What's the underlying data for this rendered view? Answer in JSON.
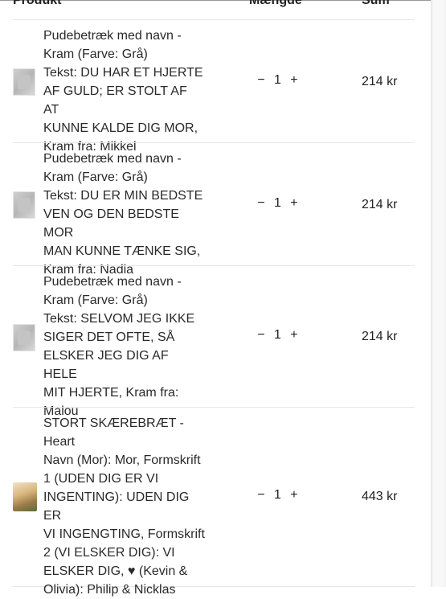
{
  "table": {
    "headers": {
      "product": "Produkt",
      "quantity": "Mængde",
      "sum": "Sum"
    },
    "rows": [
      {
        "description": "Pudebetræk med navn -\nKram (Farve: Grå)\nTekst: DU HAR ET HJERTE\nAF GULD; ER STOLT AF AT\nKUNNE KALDE DIG MOR,\nKram fra: Mikkel",
        "minus": "−",
        "qty": "1",
        "plus": "+",
        "sum": "214 kr",
        "image": "pillow-image"
      },
      {
        "description": "Pudebetræk med navn -\nKram (Farve: Grå)\nTekst: DU ER MIN BEDSTE\nVEN OG DEN BEDSTE MOR\nMAN KUNNE TÆNKE SIG,\nKram fra: Nadia",
        "minus": "−",
        "qty": "1",
        "plus": "+",
        "sum": "214 kr",
        "image": "pillow-image"
      },
      {
        "description": "Pudebetræk med navn -\nKram (Farve: Grå)\nTekst: SELVOM JEG IKKE\nSIGER DET OFTE, SÅ\nELSKER JEG DIG AF HELE\nMIT HJERTE, Kram fra:\nMalou",
        "minus": "−",
        "qty": "1",
        "plus": "+",
        "sum": "214 kr",
        "image": "pillow-image"
      },
      {
        "description": "STORT SKÆREBRÆT -\nHeart\nNavn (Mor): Mor, Formskrift\n1 (UDEN DIG ER VI\nINGENTING): UDEN DIG ER\nVI INGENGTING, Formskrift\n2 (VI ELSKER DIG): VI\nELSKER DIG, ♥ (Kevin &\nOlivia): Philip & Nicklas",
        "minus": "−",
        "qty": "1",
        "plus": "+",
        "sum": "443 kr",
        "image": "cutting-board-image"
      }
    ]
  }
}
